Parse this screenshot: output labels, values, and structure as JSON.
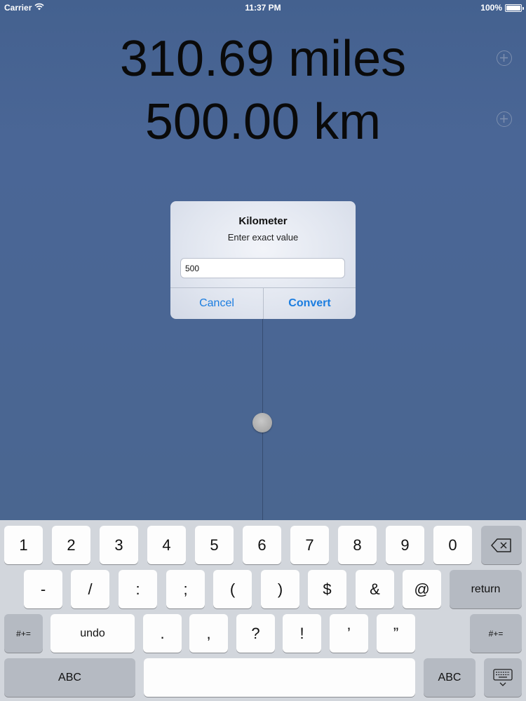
{
  "status_bar": {
    "carrier": "Carrier",
    "time": "11:37 PM",
    "battery_text": "100%",
    "battery_level": 1.0
  },
  "display": {
    "miles_value": "310.69 miles",
    "km_value": "500.00 km"
  },
  "slider": {
    "level": 0.5
  },
  "alert": {
    "title": "Kilometer",
    "message": "Enter exact value",
    "input_value": "500",
    "cancel_label": "Cancel",
    "convert_label": "Convert",
    "accent_color": "#1b7de0"
  },
  "keyboard": {
    "row1": [
      "1",
      "2",
      "3",
      "4",
      "5",
      "6",
      "7",
      "8",
      "9",
      "0"
    ],
    "row2": [
      "-",
      "/",
      ":",
      ";",
      "(",
      ")",
      "$",
      "&",
      "@"
    ],
    "return_label": "return",
    "shift_symbols_label": "#+=",
    "undo_label": "undo",
    "row3": [
      ".",
      ",",
      "?",
      "!",
      "’",
      "”"
    ],
    "abc_label": "ABC"
  }
}
